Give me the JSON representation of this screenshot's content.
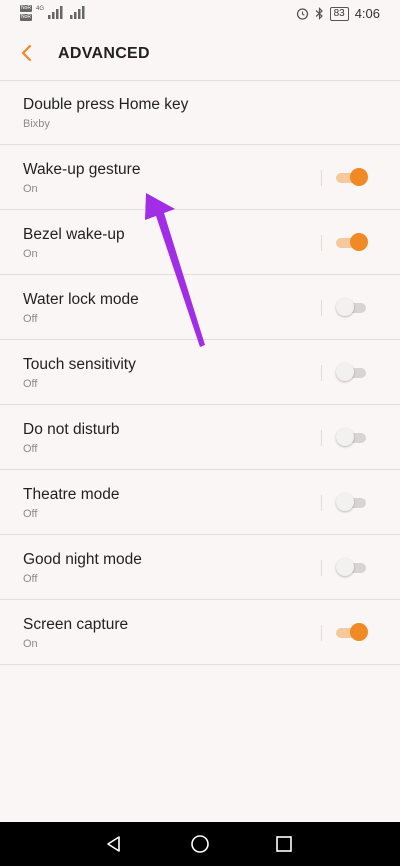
{
  "status_bar": {
    "sim1": "NoR",
    "sim2": "NoR",
    "network": "4G",
    "battery": "83",
    "time": "4:06"
  },
  "header": {
    "title": "ADVANCED",
    "accent": "#f08a24"
  },
  "settings": [
    {
      "label": "Double press Home key",
      "sub": "Bixby",
      "toggle": null
    },
    {
      "label": "Wake-up gesture",
      "sub": "On",
      "toggle": true
    },
    {
      "label": "Bezel wake-up",
      "sub": "On",
      "toggle": true
    },
    {
      "label": "Water lock mode",
      "sub": "Off",
      "toggle": false
    },
    {
      "label": "Touch sensitivity",
      "sub": "Off",
      "toggle": false
    },
    {
      "label": "Do not disturb",
      "sub": "Off",
      "toggle": false
    },
    {
      "label": "Theatre mode",
      "sub": "Off",
      "toggle": false
    },
    {
      "label": "Good night mode",
      "sub": "Off",
      "toggle": false
    },
    {
      "label": "Screen capture",
      "sub": "On",
      "toggle": true
    }
  ],
  "annotation": {
    "arrow_color": "#a12ee6"
  }
}
